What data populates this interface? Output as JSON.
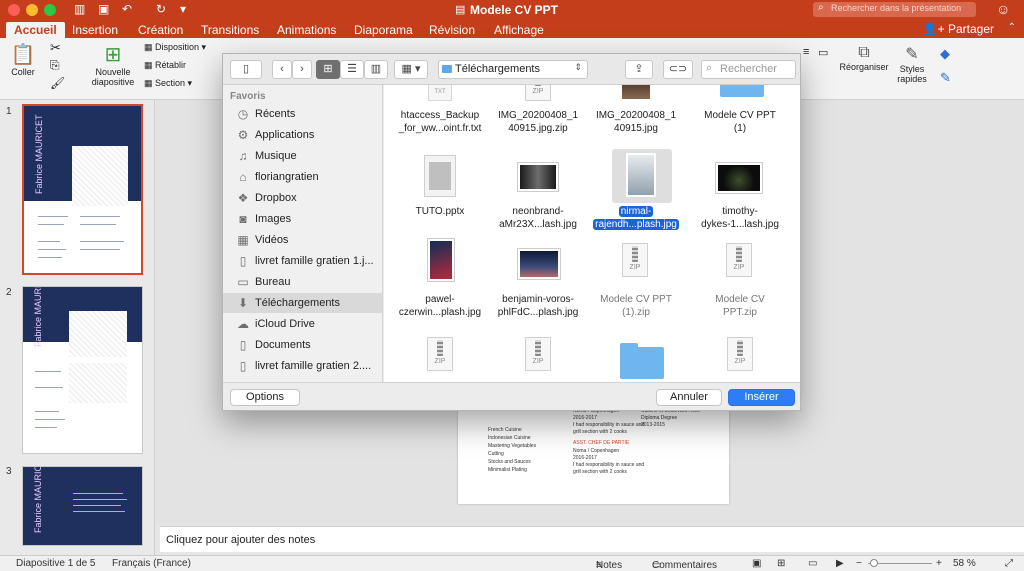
{
  "window": {
    "title": "Modele CV PPT",
    "search_placeholder": "Rechercher dans la présentation"
  },
  "ribbon_tabs": [
    "Accueil",
    "Insertion",
    "Création",
    "Transitions",
    "Animations",
    "Diaporama",
    "Révision",
    "Affichage"
  ],
  "share_label": "Partager",
  "ribbon": {
    "paste": "Coller",
    "new_slide_line1": "Nouvelle",
    "new_slide_line2": "diapositive",
    "layout": "Disposition",
    "reset": "Rétablir",
    "section": "Section",
    "arrange": "Réorganiser",
    "styles_line1": "Styles",
    "styles_line2": "rapides"
  },
  "slides": [
    {
      "num": "1",
      "name": "Fabrice MAURICET"
    },
    {
      "num": "2",
      "name": "Fabrice MAURICET"
    },
    {
      "num": "3",
      "name": "Fabrice MAURICET"
    }
  ],
  "slide_preview": {
    "skills": [
      "French Cuisine",
      "Indonesian Cuisine",
      "Mastering Vegetables",
      "Cutting",
      "Stocks and Sauces",
      "Minimalist Plating"
    ],
    "right_col": [
      "Noma / Copenhagen",
      "2016-2017",
      "I had responsibility in sauce and",
      "grill section with 2 cooks",
      "ASST. CHEF DE PARTIE",
      "Noma / Copenhagen",
      "2016-2017",
      "I had responsibility in sauce and",
      "grill section with 2 cooks"
    ],
    "far_col": [
      "Cuisine et Boulevard Hotel",
      "Diploma Degree",
      "2013-2015"
    ]
  },
  "notes_placeholder": "Cliquez pour ajouter des notes",
  "status": {
    "slide_counter": "Diapositive 1 de 5",
    "language": "Français (France)",
    "notes": "Notes",
    "comments": "Commentaires",
    "zoom": "58 %"
  },
  "dialog": {
    "location": "Téléchargements",
    "search_placeholder": "Rechercher",
    "sidebar_heading": "Favoris",
    "sidebar_items": [
      {
        "label": "Récents",
        "icon": "clock-icon"
      },
      {
        "label": "Applications",
        "icon": "applications-icon"
      },
      {
        "label": "Musique",
        "icon": "music-icon"
      },
      {
        "label": "floriangratien",
        "icon": "home-icon"
      },
      {
        "label": "Dropbox",
        "icon": "dropbox-icon"
      },
      {
        "label": "Images",
        "icon": "camera-icon"
      },
      {
        "label": "Vidéos",
        "icon": "film-icon"
      },
      {
        "label": "livret famille gratien 1.j...",
        "icon": "document-icon"
      },
      {
        "label": "Bureau",
        "icon": "desktop-icon"
      },
      {
        "label": "Téléchargements",
        "icon": "download-icon"
      },
      {
        "label": "iCloud Drive",
        "icon": "cloud-icon"
      },
      {
        "label": "Documents",
        "icon": "document-icon"
      },
      {
        "label": "livret famille gratien 2....",
        "icon": "document-icon"
      }
    ],
    "files": [
      {
        "line1": "htaccess_Backup",
        "line2": "_for_ww...oint.fr.txt",
        "kind": "txt",
        "dim": false
      },
      {
        "line1": "IMG_20200408_1",
        "line2": "40915.jpg.zip",
        "kind": "zip",
        "dim": false
      },
      {
        "line1": "IMG_20200408_1",
        "line2": "40915.jpg",
        "kind": "photo",
        "dim": false
      },
      {
        "line1": "Modele CV PPT",
        "line2": "(1)",
        "kind": "folder",
        "dim": false
      },
      {
        "line1": "TUTO.pptx",
        "line2": "",
        "kind": "pptx",
        "dim": false
      },
      {
        "line1": "neonbrand-",
        "line2": "aMr23X...lash.jpg",
        "kind": "photo",
        "dim": false
      },
      {
        "line1": "nirmal-",
        "line2": "rajendh...plash.jpg",
        "kind": "photo",
        "dim": false,
        "selected": true
      },
      {
        "line1": "timothy-",
        "line2": "dykes-1...lash.jpg",
        "kind": "photo",
        "dim": false
      },
      {
        "line1": "pawel-",
        "line2": "czerwin...plash.jpg",
        "kind": "photo",
        "dim": false
      },
      {
        "line1": "benjamin-voros-",
        "line2": "phlFdC...plash.jpg",
        "kind": "photo",
        "dim": false
      },
      {
        "line1": "Modele CV PPT",
        "line2": "(1).zip",
        "kind": "zip",
        "dim": true
      },
      {
        "line1": "Modele CV",
        "line2": "PPT.zip",
        "kind": "zip",
        "dim": true
      },
      {
        "line1": "",
        "line2": "",
        "kind": "zip",
        "dim": true
      },
      {
        "line1": "",
        "line2": "",
        "kind": "zip",
        "dim": true
      },
      {
        "line1": "",
        "line2": "",
        "kind": "folder",
        "dim": false
      },
      {
        "line1": "",
        "line2": "",
        "kind": "zip",
        "dim": true
      }
    ],
    "options_button": "Options",
    "cancel_button": "Annuler",
    "insert_button": "Insérer",
    "zip_label": "ZIP",
    "txt_label": "TXT"
  },
  "colors": {
    "accent": "#c43e1c",
    "selection": "#1a64d6",
    "primary_button": "#2e7df6",
    "slide_navy": "#1f2f5e"
  }
}
